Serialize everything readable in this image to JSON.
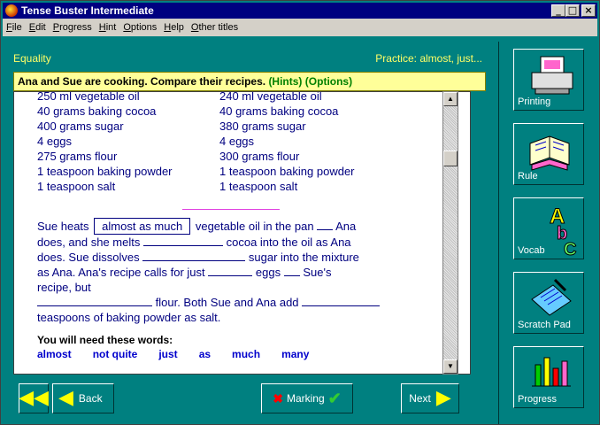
{
  "window": {
    "title": "Tense Buster Intermediate"
  },
  "menu": [
    "File",
    "Edit",
    "Progress",
    "Hint",
    "Options",
    "Help",
    "Other titles"
  ],
  "header": {
    "section": "Equality",
    "practice": "Practice: almost, just..."
  },
  "instruction": {
    "main": "Ana and Sue are cooking. Compare their recipes.",
    "hints": "(Hints)",
    "options": "(Options)"
  },
  "recipes": {
    "left": [
      "250 ml vegetable oil",
      "40 grams baking cocoa",
      "400 grams sugar",
      "4 eggs",
      "275 grams flour",
      "1 teaspoon baking powder",
      "1 teaspoon salt"
    ],
    "right": [
      "240 ml vegetable oil",
      "40 grams baking cocoa",
      "380 grams sugar",
      "4 eggs",
      "300 grams flour",
      "1 teaspoon baking powder",
      "1 teaspoon salt"
    ]
  },
  "exercise": {
    "p1": "Sue heats",
    "answer": "almost as much",
    "p2": "vegetable oil in the pan",
    "p3": "Ana",
    "p4": "does, and she melts",
    "p5": "cocoa into the oil as Ana",
    "p6": "does. Sue dissolves",
    "p7": "sugar into the mixture",
    "p8": "as Ana. Ana's recipe calls for just",
    "p9": "eggs",
    "p10": "Sue's",
    "p11": "recipe, but",
    "p12": "flour. Both Sue and Ana add",
    "p13": "teaspoons of baking powder as salt."
  },
  "words": {
    "title": "You will need these words:",
    "list": [
      "almost",
      "not quite",
      "just",
      "as",
      "much",
      "many"
    ]
  },
  "buttons": {
    "back": "Back",
    "marking": "Marking",
    "next": "Next"
  },
  "side": {
    "printing": "Printing",
    "rule": "Rule",
    "vocab": "Vocab",
    "scratch": "Scratch Pad",
    "progress": "Progress"
  }
}
